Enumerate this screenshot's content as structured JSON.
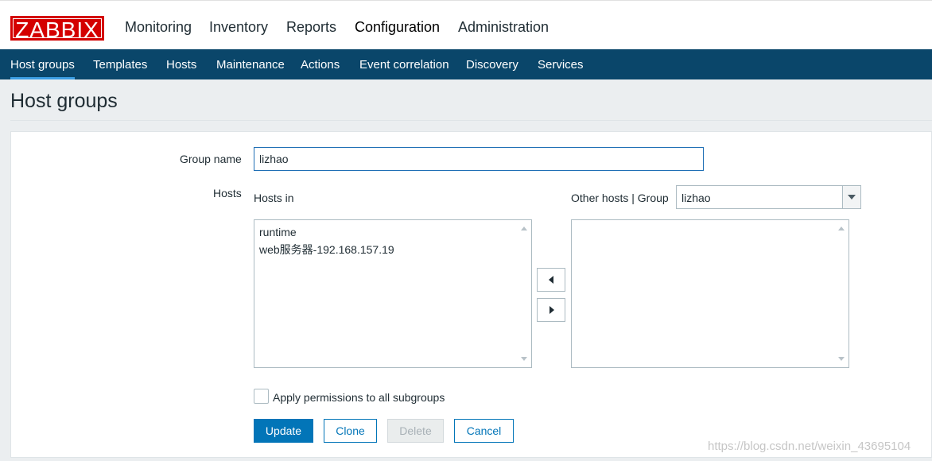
{
  "app": {
    "logo": "ZABBIX"
  },
  "main_nav": [
    {
      "label": "Monitoring",
      "active": false
    },
    {
      "label": "Inventory",
      "active": false
    },
    {
      "label": "Reports",
      "active": false
    },
    {
      "label": "Configuration",
      "active": true
    },
    {
      "label": "Administration",
      "active": false
    }
  ],
  "sub_nav": [
    {
      "label": "Host groups",
      "active": true
    },
    {
      "label": "Templates",
      "active": false
    },
    {
      "label": "Hosts",
      "active": false
    },
    {
      "label": "Maintenance",
      "active": false
    },
    {
      "label": "Actions",
      "active": false
    },
    {
      "label": "Event correlation",
      "active": false
    },
    {
      "label": "Discovery",
      "active": false
    },
    {
      "label": "Services",
      "active": false
    }
  ],
  "page": {
    "title": "Host groups"
  },
  "form": {
    "group_name_label": "Group name",
    "group_name_value": "lizhao",
    "hosts_label": "Hosts",
    "hosts_in_label": "Hosts in",
    "hosts_in": [
      "runtime",
      "web服务器-192.168.157.19"
    ],
    "other_hosts_label": "Other hosts | Group",
    "other_group_selected": "lizhao",
    "other_hosts": [],
    "apply_subgroups_label": "Apply permissions to all subgroups",
    "apply_subgroups_checked": false,
    "buttons": {
      "update": "Update",
      "clone": "Clone",
      "delete": "Delete",
      "cancel": "Cancel"
    }
  },
  "watermark": "https://blog.csdn.net/weixin_43695104",
  "colors": {
    "brand_red": "#d40000",
    "subnav_bg": "#0a466a",
    "primary_blue": "#0275b8"
  }
}
